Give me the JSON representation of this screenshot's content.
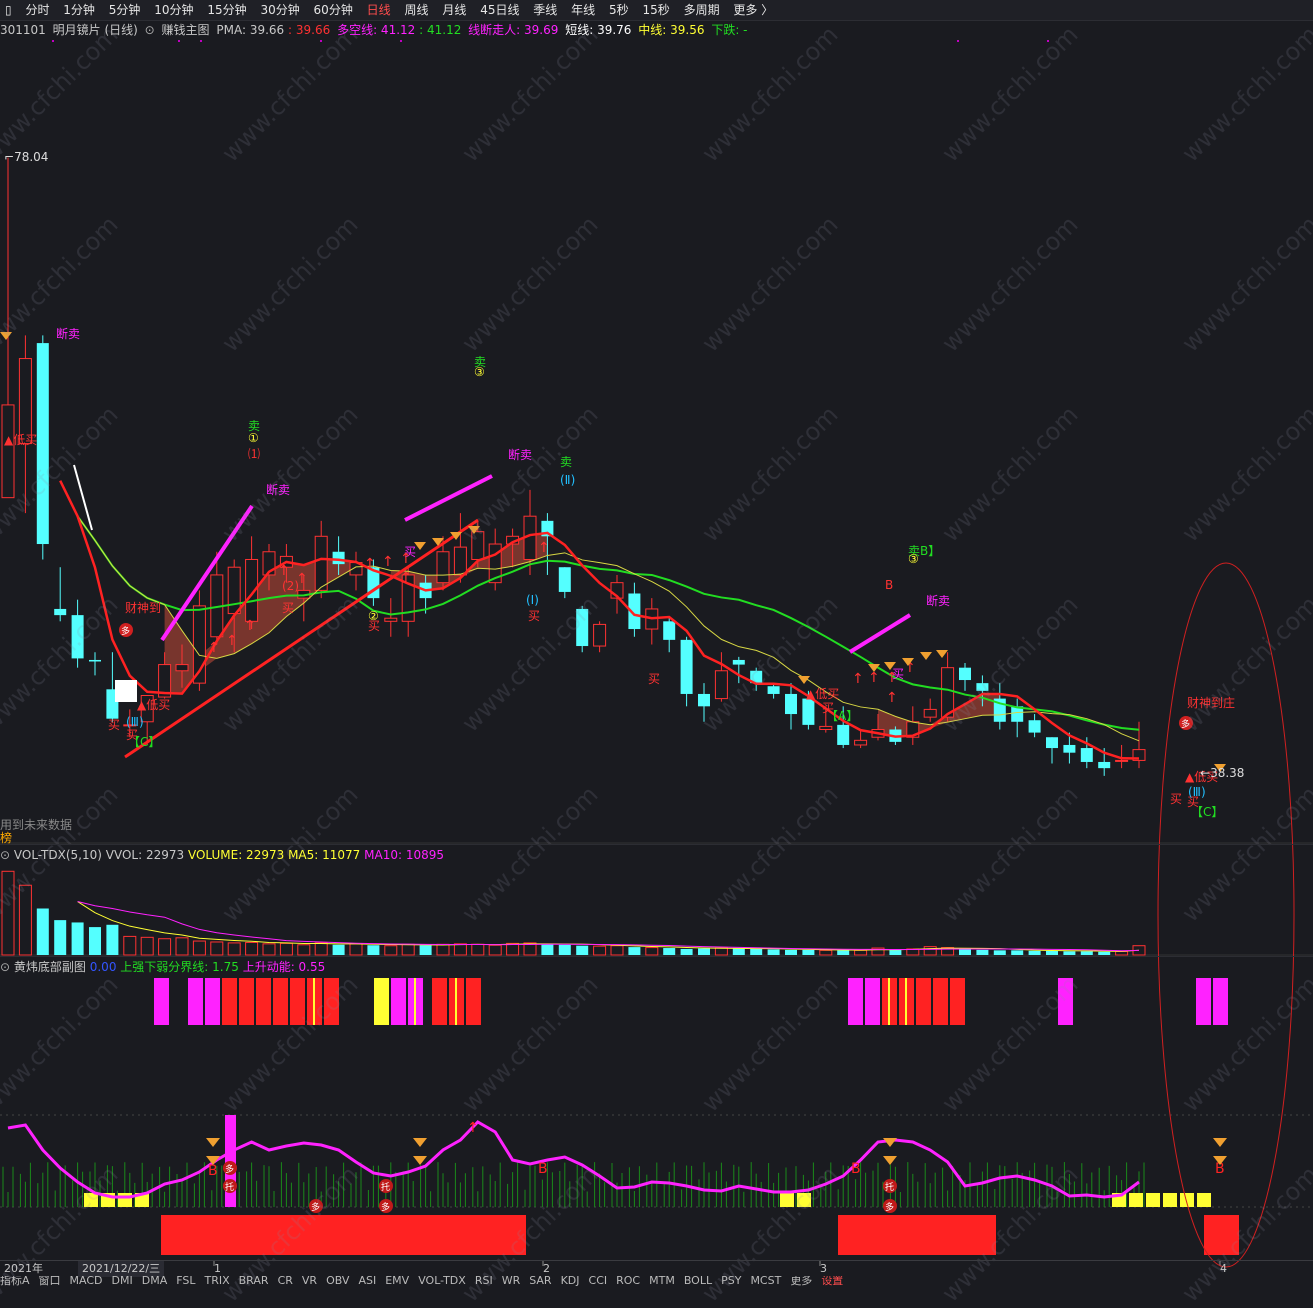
{
  "period_bar": {
    "items": [
      "分时",
      "1分钟",
      "5分钟",
      "10分钟",
      "15分钟",
      "30分钟",
      "60分钟",
      "日线",
      "周线",
      "月线",
      "45日线",
      "季线",
      "年线",
      "5秒",
      "15秒",
      "多周期",
      "更多 〉"
    ],
    "active": "日线"
  },
  "main_info": {
    "code": "301101",
    "name": "明月镜片 (日线)",
    "indicator": "赚钱主图",
    "pma_label": "PMA: 39.66",
    "pma_red": ": 39.66",
    "duokong_label": "多空线: 41.12",
    "duokong_green": ": 41.12",
    "xdzr_label": "线断走人: 39.69",
    "short_label": "短线: 39.76",
    "mid_label": "中线: 39.56",
    "down_label": "下跌: -"
  },
  "price_labels": {
    "high": "78.04",
    "low": "38.38"
  },
  "future_note": "用到未来数据",
  "small_tag": "榜",
  "vol_info": {
    "name": "VOL-TDX(5,10)",
    "vvol": "VVOL: 22973",
    "volume": "VOLUME: 22973",
    "ma5": "MA5: 11077",
    "ma10": "MA10: 10895"
  },
  "sub_info": {
    "name": "黄炜底部副图",
    "zero": "0.00",
    "line1": "上强下弱分界线: 1.75",
    "line2": "上升动能: 0.55"
  },
  "date_bar": {
    "year": "2021年",
    "date": "2021/12/22/三",
    "m1": "1",
    "m2": "2",
    "m3": "3",
    "m4": "4"
  },
  "ind_bar": [
    "指标A",
    "窗口",
    "MACD",
    "DMI",
    "DMA",
    "FSL",
    "TRIX",
    "BRAR",
    "CR",
    "VR",
    "OBV",
    "ASI",
    "EMV",
    "VOL-TDX",
    "RSI",
    "WR",
    "SAR",
    "KDJ",
    "CCI",
    "ROC",
    "MTM",
    "BOLL",
    "PSY",
    "MCST",
    "更多",
    "设置"
  ],
  "watermark": "www.cfchi.com",
  "annotations": {
    "sell": "卖",
    "buy": "买",
    "break_sell": "断卖",
    "low_buy": "▲低买",
    "fortune": "财神到",
    "wave1": "(Ⅰ)",
    "wave2": "(Ⅱ)",
    "wave3": "(Ⅲ)",
    "waveA": "【A】",
    "waveC": "【C】",
    "sellB": "卖B】",
    "circle1": "①",
    "circle2": "②",
    "circle3": "③",
    "paren1": "⑴",
    "paren2": "(2)",
    "B": "B",
    "duo": "多",
    "tuo": "托",
    "fortune_end": "财神到庄"
  },
  "colors": {
    "up": "#ff3232",
    "down": "#54ffff",
    "ma_green": "#22dd22",
    "ma_red": "#ff2222",
    "ma_white": "#ffffff",
    "magenta": "#ff22ff",
    "yellow": "#ffff33",
    "fill": "#8a3a30"
  },
  "chart_data": {
    "type": "candlestick",
    "title": "明月镜片 (日线)",
    "price_range": [
      38.38,
      78.04
    ],
    "candles": [
      {
        "o": 56.0,
        "h": 78.0,
        "l": 56.0,
        "c": 62.0
      },
      {
        "o": 59.5,
        "h": 66.5,
        "l": 55.0,
        "c": 65.0
      },
      {
        "o": 66.0,
        "h": 66.5,
        "l": 52.0,
        "c": 53.0
      },
      {
        "o": 48.8,
        "h": 51.5,
        "l": 48.0,
        "c": 48.4
      },
      {
        "o": 48.4,
        "h": 49.4,
        "l": 45.0,
        "c": 45.6
      },
      {
        "o": 45.5,
        "h": 46.0,
        "l": 44.5,
        "c": 45.4
      },
      {
        "o": 43.6,
        "h": 46.0,
        "l": 41.5,
        "c": 41.7
      },
      {
        "o": 41.3,
        "h": 42.3,
        "l": 40.5,
        "c": 41.3
      },
      {
        "o": 41.5,
        "h": 43.0,
        "l": 40.0,
        "c": 43.2
      },
      {
        "o": 43.1,
        "h": 46.0,
        "l": 43.0,
        "c": 45.2
      },
      {
        "o": 44.8,
        "h": 46.5,
        "l": 43.7,
        "c": 45.2
      },
      {
        "o": 44.0,
        "h": 50.0,
        "l": 43.5,
        "c": 49.0
      },
      {
        "o": 47.0,
        "h": 52.5,
        "l": 46.5,
        "c": 51.0
      },
      {
        "o": 48.5,
        "h": 52.0,
        "l": 46.0,
        "c": 51.5
      },
      {
        "o": 48.0,
        "h": 53.5,
        "l": 47.5,
        "c": 52.0
      },
      {
        "o": 51.0,
        "h": 53.0,
        "l": 50.0,
        "c": 52.5
      },
      {
        "o": 51.5,
        "h": 53.0,
        "l": 50.5,
        "c": 52.2
      },
      {
        "o": 49.5,
        "h": 51.0,
        "l": 48.0,
        "c": 50.0
      },
      {
        "o": 50.0,
        "h": 54.5,
        "l": 49.5,
        "c": 53.5
      },
      {
        "o": 52.5,
        "h": 53.5,
        "l": 51.0,
        "c": 51.7
      },
      {
        "o": 51.0,
        "h": 52.5,
        "l": 50.0,
        "c": 51.8
      },
      {
        "o": 51.5,
        "h": 52.0,
        "l": 49.0,
        "c": 49.5
      },
      {
        "o": 48.0,
        "h": 49.5,
        "l": 47.0,
        "c": 48.2
      },
      {
        "o": 48.0,
        "h": 51.5,
        "l": 47.0,
        "c": 51.0
      },
      {
        "o": 50.5,
        "h": 51.0,
        "l": 48.5,
        "c": 49.5
      },
      {
        "o": 50.5,
        "h": 53.5,
        "l": 50.0,
        "c": 52.5
      },
      {
        "o": 51.0,
        "h": 55.0,
        "l": 50.5,
        "c": 52.8
      },
      {
        "o": 52.0,
        "h": 54.5,
        "l": 51.5,
        "c": 53.8
      },
      {
        "o": 50.5,
        "h": 54.0,
        "l": 50.0,
        "c": 53.0
      },
      {
        "o": 53.0,
        "h": 54.0,
        "l": 51.5,
        "c": 53.5
      },
      {
        "o": 52.0,
        "h": 56.5,
        "l": 51.0,
        "c": 54.8
      },
      {
        "o": 54.5,
        "h": 55.0,
        "l": 51.0,
        "c": 53.5
      },
      {
        "o": 51.5,
        "h": 51.5,
        "l": 49.5,
        "c": 49.9
      },
      {
        "o": 48.8,
        "h": 49.0,
        "l": 46.0,
        "c": 46.4
      },
      {
        "o": 46.4,
        "h": 48.0,
        "l": 46.0,
        "c": 47.8
      },
      {
        "o": 49.5,
        "h": 51.0,
        "l": 48.5,
        "c": 50.5
      },
      {
        "o": 49.8,
        "h": 50.5,
        "l": 47.0,
        "c": 47.5
      },
      {
        "o": 47.5,
        "h": 49.5,
        "l": 46.5,
        "c": 48.8
      },
      {
        "o": 48.0,
        "h": 48.2,
        "l": 46.0,
        "c": 46.8
      },
      {
        "o": 46.8,
        "h": 47.0,
        "l": 42.5,
        "c": 43.3
      },
      {
        "o": 43.3,
        "h": 44.0,
        "l": 41.5,
        "c": 42.5
      },
      {
        "o": 43.0,
        "h": 46.0,
        "l": 42.8,
        "c": 44.8
      },
      {
        "o": 45.5,
        "h": 45.7,
        "l": 44.0,
        "c": 45.2
      },
      {
        "o": 44.8,
        "h": 45.0,
        "l": 43.5,
        "c": 44.0
      },
      {
        "o": 43.8,
        "h": 44.0,
        "l": 43.0,
        "c": 43.3
      },
      {
        "o": 43.3,
        "h": 44.0,
        "l": 41.0,
        "c": 42.0
      },
      {
        "o": 43.0,
        "h": 43.5,
        "l": 41.0,
        "c": 41.3
      },
      {
        "o": 41.0,
        "h": 42.5,
        "l": 40.8,
        "c": 41.2
      },
      {
        "o": 41.3,
        "h": 42.5,
        "l": 39.8,
        "c": 40.0
      },
      {
        "o": 40.0,
        "h": 41.0,
        "l": 39.8,
        "c": 40.3
      },
      {
        "o": 40.5,
        "h": 42.0,
        "l": 40.3,
        "c": 41.0
      },
      {
        "o": 41.0,
        "h": 41.2,
        "l": 40.0,
        "c": 40.2
      },
      {
        "o": 40.5,
        "h": 42.5,
        "l": 40.0,
        "c": 41.5
      },
      {
        "o": 41.8,
        "h": 43.0,
        "l": 41.5,
        "c": 42.3
      },
      {
        "o": 41.8,
        "h": 46.0,
        "l": 41.5,
        "c": 45.0
      },
      {
        "o": 45.0,
        "h": 45.3,
        "l": 43.5,
        "c": 44.2
      },
      {
        "o": 44.0,
        "h": 44.5,
        "l": 42.5,
        "c": 43.5
      },
      {
        "o": 43.0,
        "h": 44.0,
        "l": 41.0,
        "c": 41.5
      },
      {
        "o": 42.5,
        "h": 43.0,
        "l": 40.5,
        "c": 41.5
      },
      {
        "o": 41.6,
        "h": 42.0,
        "l": 40.5,
        "c": 40.8
      },
      {
        "o": 40.5,
        "h": 40.5,
        "l": 38.8,
        "c": 39.8
      },
      {
        "o": 40.0,
        "h": 40.8,
        "l": 38.8,
        "c": 39.5
      },
      {
        "o": 39.8,
        "h": 40.5,
        "l": 38.5,
        "c": 38.9
      },
      {
        "o": 38.9,
        "h": 39.8,
        "l": 38.0,
        "c": 38.5
      },
      {
        "o": 39.0,
        "h": 40.0,
        "l": 38.5,
        "c": 39.0
      },
      {
        "o": 39.0,
        "h": 41.5,
        "l": 38.5,
        "c": 39.7
      }
    ],
    "volume": [
      18000,
      15000,
      10000,
      7500,
      7000,
      6000,
      6500,
      4000,
      3800,
      3500,
      3700,
      3000,
      2800,
      2600,
      2700,
      2400,
      2500,
      2200,
      2600,
      2200,
      2400,
      2100,
      2000,
      2300,
      2100,
      2300,
      2400,
      2300,
      2100,
      2500,
      2600,
      2400,
      2200,
      2000,
      1900,
      2000,
      1700,
      1600,
      1500,
      1300,
      1400,
      1500,
      1400,
      1300,
      1200,
      1100,
      1100,
      1000,
      1000,
      1000,
      1500,
      1200,
      1300,
      1800,
      1600,
      1300,
      1100,
      1000,
      1000,
      900,
      900,
      800,
      800,
      700,
      750,
      2000
    ],
    "ma5_volume": 11077,
    "ma10_volume": 10895,
    "vvol": 22973,
    "sub_indicator": {
      "upper_lower_divider": 1.75,
      "rising_momentum": 0.55
    }
  }
}
